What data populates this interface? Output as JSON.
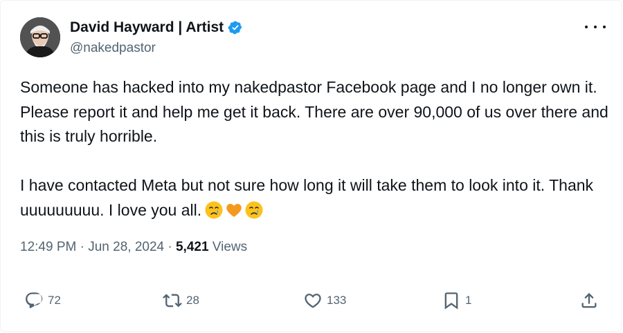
{
  "author": {
    "display_name": "David Hayward | Artist",
    "handle": "@nakedpastor",
    "verified": true,
    "avatar_icon": "avatar-photo"
  },
  "tweet": {
    "paragraph_1": "Someone has hacked into my nakedpastor Facebook page and I no longer own it. Please report it and help me get it back. There are over 90,000 of us over there and this is truly horrible.",
    "paragraph_2": "I have contacted Meta but not sure how long it will take them to look into it. Thank uuuuuuuuu. I love you all.",
    "emojis": [
      "crying-face",
      "orange-heart",
      "crying-face"
    ]
  },
  "meta": {
    "time": "12:49 PM",
    "sep1": " · ",
    "date": "Jun 28, 2024",
    "sep2": " · ",
    "views_count": "5,421",
    "views_label": " Views"
  },
  "actions": {
    "replies": "72",
    "reposts": "28",
    "likes": "133",
    "bookmarks": "1"
  },
  "colors": {
    "text": "#0f1419",
    "secondary": "#536471",
    "verified": "#1d9bf0",
    "border": "#eff3f4"
  }
}
